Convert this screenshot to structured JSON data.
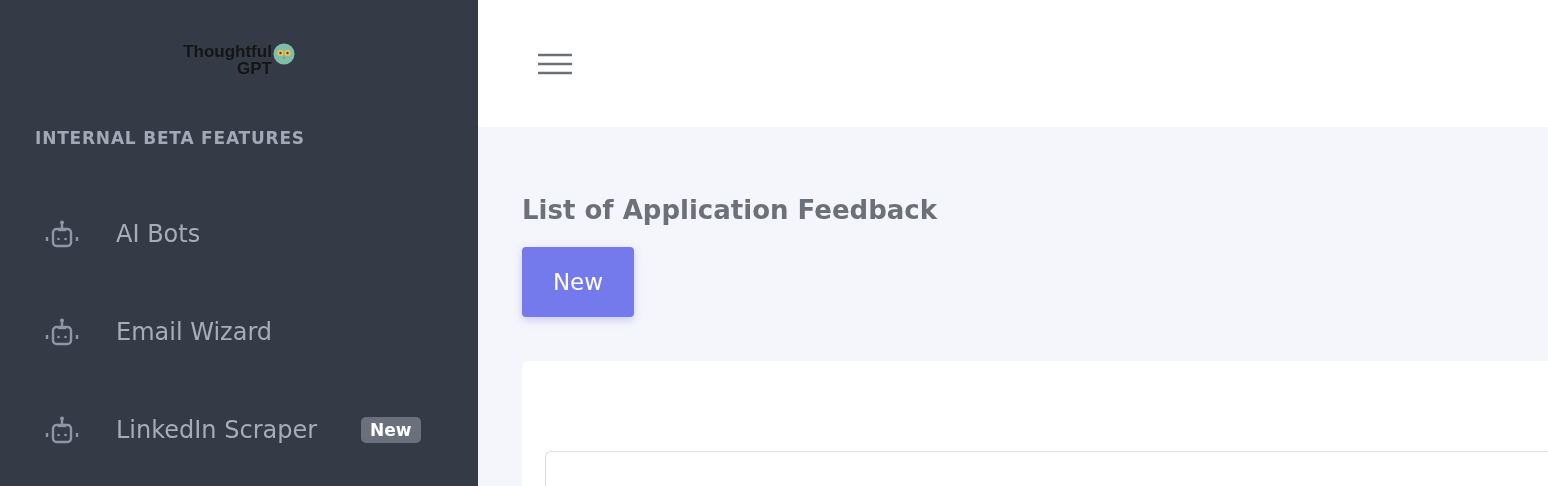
{
  "sidebar": {
    "logo": {
      "line_1": "Thoughtful",
      "line_2": "GPT"
    },
    "section_title": "INTERNAL BETA FEATURES",
    "items": [
      {
        "label": "AI Bots"
      },
      {
        "label": "Email Wizard"
      },
      {
        "label": "LinkedIn Scraper",
        "badge": "New"
      }
    ]
  },
  "page": {
    "title": "List of Application Feedback",
    "new_button": "New"
  }
}
